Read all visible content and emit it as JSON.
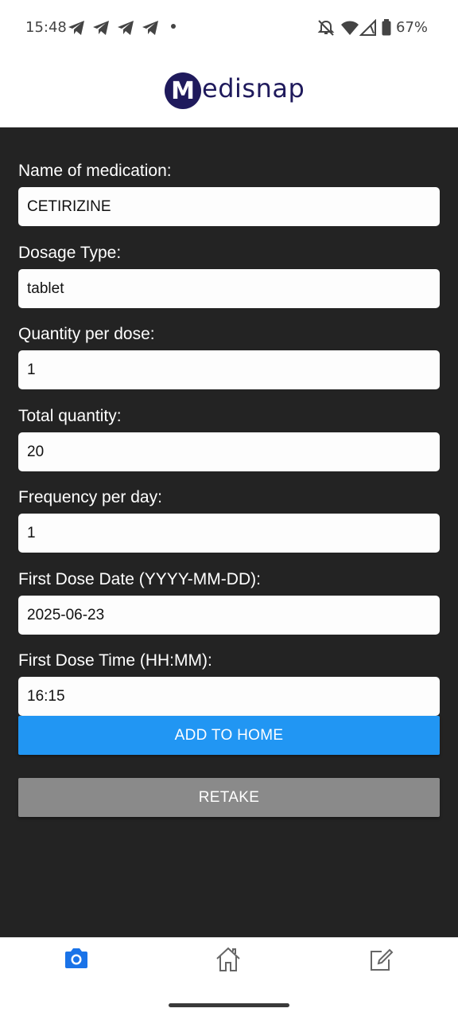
{
  "status_bar": {
    "time": "15:48",
    "battery": "67%"
  },
  "header": {
    "logo_letter": "M",
    "logo_text": "edisnap"
  },
  "form": {
    "name_label": "Name of medication:",
    "name_value": "CETIRIZINE",
    "dosage_type_label": "Dosage Type:",
    "dosage_type_value": "tablet",
    "quantity_per_dose_label": "Quantity per dose:",
    "quantity_per_dose_value": "1",
    "total_quantity_label": "Total quantity:",
    "total_quantity_value": "20",
    "frequency_label": "Frequency per day:",
    "frequency_value": "1",
    "first_dose_date_label": "First Dose Date (YYYY-MM-DD):",
    "first_dose_date_value": "2025-06-23",
    "first_dose_time_label": "First Dose Time (HH:MM):",
    "first_dose_time_value": "16:15"
  },
  "actions": {
    "add_label": "ADD TO HOME",
    "retake_label": "RETAKE"
  },
  "bottom_nav": {
    "items": [
      {
        "icon": "camera-icon",
        "active": true
      },
      {
        "icon": "home-icon",
        "active": false
      },
      {
        "icon": "edit-icon",
        "active": false
      }
    ]
  },
  "colors": {
    "brand": "#1f1a5c",
    "primary_button": "#2196f3",
    "secondary_button": "#8a8a8a",
    "background": "#232323",
    "active_nav": "#1a73e8"
  }
}
